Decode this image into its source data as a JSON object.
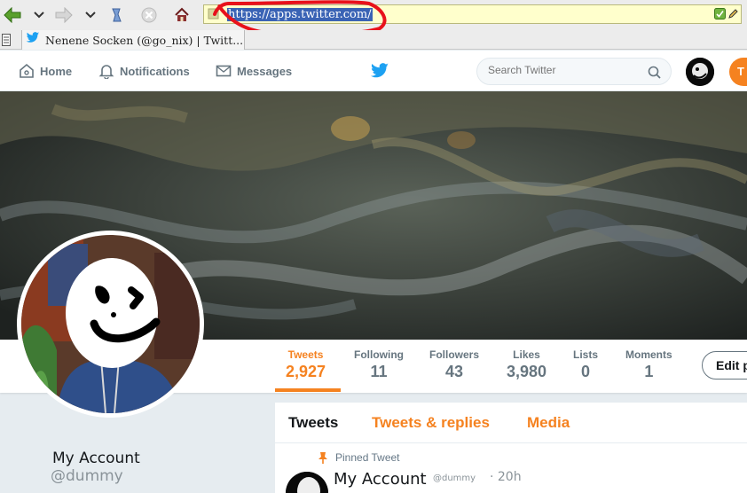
{
  "browser": {
    "url": "https://apps.twitter.com/",
    "tab_title": "Nenene Socken (@go_nix) | Twitt..."
  },
  "header": {
    "nav": {
      "home": "Home",
      "notifications": "Notifications",
      "messages": "Messages"
    },
    "search_placeholder": "Search Twitter",
    "tweet_button": "T"
  },
  "profile": {
    "stats": [
      {
        "label": "Tweets",
        "value": "2,927"
      },
      {
        "label": "Following",
        "value": "11"
      },
      {
        "label": "Followers",
        "value": "43"
      },
      {
        "label": "Likes",
        "value": "3,980"
      },
      {
        "label": "Lists",
        "value": "0"
      },
      {
        "label": "Moments",
        "value": "1"
      }
    ],
    "edit_button": "Edit p",
    "name": "My Account",
    "handle": "@dummy"
  },
  "timeline": {
    "tabs": {
      "tweets": "Tweets",
      "replies": "Tweets & replies",
      "media": "Media"
    },
    "pinned_label": "Pinned Tweet",
    "tweet": {
      "name": "My Account",
      "handle": "@dummy",
      "time": "· 20h"
    }
  },
  "colors": {
    "accent": "#f58220",
    "twitter_blue": "#1da1f2",
    "text_muted": "#66757f",
    "annotation_red": "#e8111b"
  }
}
